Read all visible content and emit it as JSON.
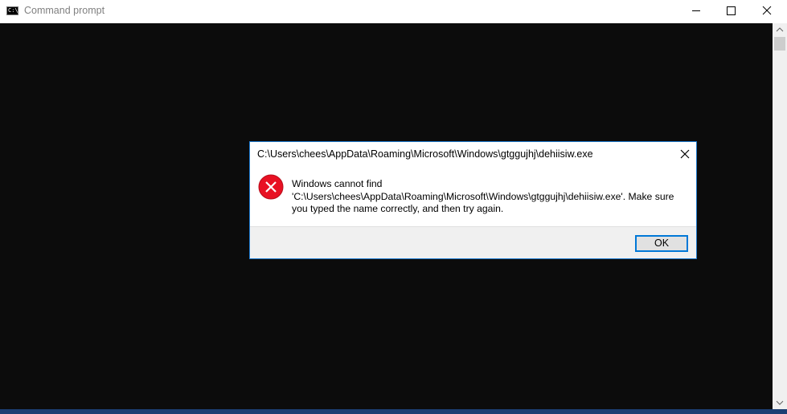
{
  "window": {
    "title": "Command prompt",
    "app_icon_glyph": "C:\\",
    "controls": [
      "minimize-icon",
      "maximize-icon",
      "close-icon"
    ]
  },
  "dialog": {
    "title": "C:\\Users\\chees\\AppData\\Roaming\\Microsoft\\Windows\\gtggujhj\\dehiisiw.exe",
    "icon": "error-icon",
    "message_lines": [
      "Windows cannot find",
      "'C:\\Users\\chees\\AppData\\Roaming\\Microsoft\\Windows\\gtggujhj\\dehiisiw.exe'. Make sure",
      "you typed the name correctly, and then try again."
    ],
    "ok_label": "OK"
  },
  "colors": {
    "console_background": "#0c0c0c",
    "dialog_border": "#1f7bd0",
    "button_focus": "#0078d7",
    "error_red": "#e81123"
  }
}
